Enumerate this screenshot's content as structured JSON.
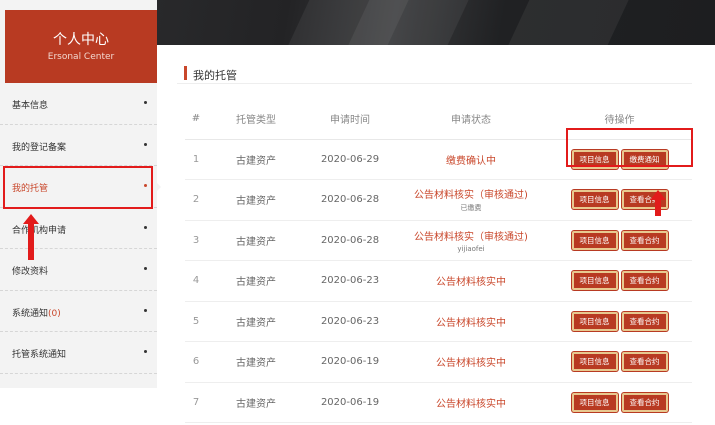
{
  "sidebar": {
    "title": "个人中心",
    "subtitle": "Ersonal Center",
    "items": [
      {
        "label": "基本信息",
        "count": ""
      },
      {
        "label": "我的登记备案",
        "count": ""
      },
      {
        "label": "我的托管",
        "count": "",
        "active": true
      },
      {
        "label": "合作机构申请",
        "count": ""
      },
      {
        "label": "修改资料",
        "count": ""
      },
      {
        "label": "系统通知",
        "count": "(0)"
      },
      {
        "label": "托管系统通知",
        "count": ""
      }
    ]
  },
  "main": {
    "section_title": "我的托管",
    "columns": [
      "#",
      "托管类型",
      "申请时间",
      "申请状态",
      "待操作"
    ],
    "rows": [
      {
        "idx": "1",
        "type": "古建资产",
        "date": "2020-06-29",
        "status": "缴费确认中",
        "note": "",
        "btn1": "项目信息",
        "btn2": "缴费通知"
      },
      {
        "idx": "2",
        "type": "古建资产",
        "date": "2020-06-28",
        "status": "公告材料核实（审核通过)",
        "note": "已缴费",
        "btn1": "项目信息",
        "btn2": "查看合约"
      },
      {
        "idx": "3",
        "type": "古建资产",
        "date": "2020-06-28",
        "status": "公告材料核实（审核通过)",
        "note": "yijiaofei",
        "btn1": "项目信息",
        "btn2": "查看合约"
      },
      {
        "idx": "4",
        "type": "古建资产",
        "date": "2020-06-23",
        "status": "公告材料核实中",
        "note": "",
        "btn1": "项目信息",
        "btn2": "查看合约"
      },
      {
        "idx": "5",
        "type": "古建资产",
        "date": "2020-06-23",
        "status": "公告材料核实中",
        "note": "",
        "btn1": "项目信息",
        "btn2": "查看合约"
      },
      {
        "idx": "6",
        "type": "古建资产",
        "date": "2020-06-19",
        "status": "公告材料核实中",
        "note": "",
        "btn1": "项目信息",
        "btn2": "查看合约"
      },
      {
        "idx": "7",
        "type": "古建资产",
        "date": "2020-06-19",
        "status": "公告材料核实中",
        "note": "",
        "btn1": "项目信息",
        "btn2": "查看合约"
      }
    ]
  },
  "colors": {
    "accent": "#b83a22",
    "status_text": "#c9472b",
    "annotation_red": "#e21b1b",
    "button_border": "#e8c990"
  }
}
